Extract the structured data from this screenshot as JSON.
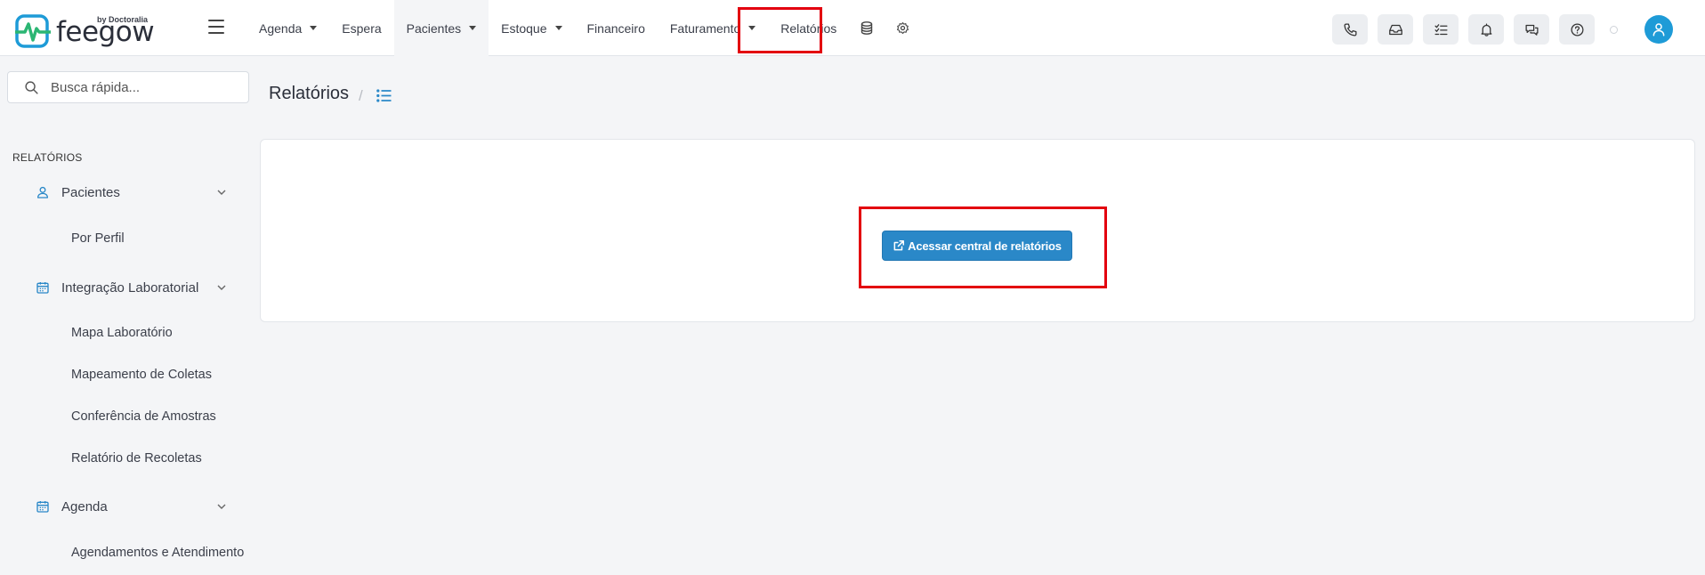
{
  "brand": {
    "name": "feegow",
    "byline": "by Doctoralia",
    "accent": "#1e9bd7",
    "logo_green": "#2bb673"
  },
  "nav": {
    "items": [
      {
        "label": "Agenda",
        "dropdown": true
      },
      {
        "label": "Espera",
        "dropdown": false
      },
      {
        "label": "Pacientes",
        "dropdown": true
      },
      {
        "label": "Estoque",
        "dropdown": true
      },
      {
        "label": "Financeiro",
        "dropdown": false
      },
      {
        "label": "Faturamento",
        "dropdown": true
      },
      {
        "label": "Relatórios",
        "dropdown": false
      }
    ],
    "icon_items": [
      "database-icon",
      "gear-icon"
    ],
    "highlight_color": "#e3000f"
  },
  "toolbar_icons": [
    "phone-icon",
    "inbox-icon",
    "checklist-icon",
    "bell-icon",
    "chat-icon",
    "help-icon"
  ],
  "search": {
    "placeholder": "Busca rápida..."
  },
  "sidebar": {
    "section_title": "RELATÓRIOS",
    "groups": [
      {
        "label": "Pacientes",
        "icon": "user-icon",
        "items": [
          "Por Perfil"
        ]
      },
      {
        "label": "Integração Laboratorial",
        "icon": "calendar-icon",
        "items": [
          "Mapa Laboratório",
          "Mapeamento de Coletas",
          "Conferência de Amostras",
          "Relatório de Recoletas"
        ]
      },
      {
        "label": "Agenda",
        "icon": "calendar-icon",
        "items": [
          "Agendamentos e Atendimento"
        ]
      }
    ]
  },
  "main": {
    "title": "Relatórios",
    "breadcrumb_separator": "/",
    "cta_label": "Acessar central de relatórios",
    "cta_color": "#2a88c8"
  }
}
